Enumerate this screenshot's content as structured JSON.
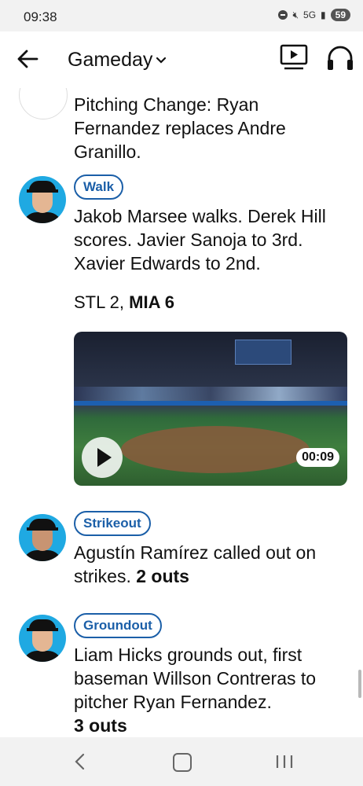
{
  "status_bar": {
    "time": "09:38",
    "network": "5G",
    "battery": "59"
  },
  "header": {
    "title": "Gameday",
    "dropdown_icon": "chevron-down-icon",
    "back_icon": "arrow-left-icon",
    "tv_icon": "tv-play-icon",
    "audio_icon": "headphones-icon"
  },
  "feed": {
    "items": [
      {
        "type": "",
        "text": "Pitching Change: Ryan Fernandez replaces Andre Granillo."
      },
      {
        "type": "Walk",
        "text": "Jakob Marsee walks. Derek Hill scores. Javier Sanoja to 3rd. Xavier Edwards to 2nd.",
        "score": {
          "away": "STL 2,",
          "home": "MIA 6"
        },
        "video": {
          "duration": "00:09"
        }
      },
      {
        "type": "Strikeout",
        "text": "Agustín Ramírez called out on strikes.",
        "outs": "2 outs"
      },
      {
        "type": "Groundout",
        "text": "Liam Hicks grounds out, first baseman Willson Contreras to pitcher Ryan Fernandez.",
        "outs": "3 outs"
      }
    ]
  },
  "colors": {
    "accent": "#1b5fa8",
    "avatar_bg": "#1fa9e2"
  }
}
